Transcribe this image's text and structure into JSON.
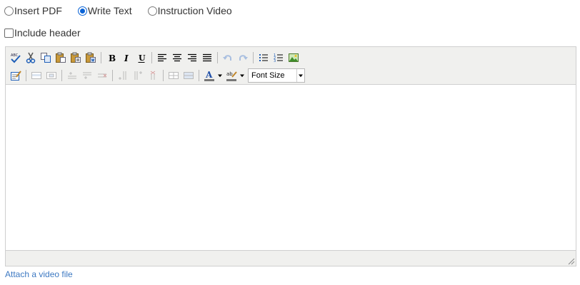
{
  "content_type": {
    "options": [
      {
        "label": "Insert PDF",
        "checked": false
      },
      {
        "label": "Write Text",
        "checked": true
      },
      {
        "label": "Instruction Video",
        "checked": false
      }
    ]
  },
  "include_header": {
    "label": "Include header",
    "checked": false
  },
  "editor": {
    "toolbar_row1": [
      "spellcheck-icon",
      "cut-icon",
      "copy-icon",
      "paste-icon",
      "paste-text-icon",
      "paste-word-icon",
      "bold-icon",
      "italic-icon",
      "underline-icon",
      "align-left-icon",
      "align-center-icon",
      "align-right-icon",
      "align-justify-icon",
      "undo-icon",
      "redo-icon",
      "unordered-list-icon",
      "ordered-list-icon",
      "insert-image-icon"
    ],
    "toolbar_row2": [
      "edit-html-icon",
      "table-row-props-icon",
      "table-cell-props-icon",
      "insert-row-before-icon",
      "insert-row-after-icon",
      "delete-row-icon",
      "insert-col-before-icon",
      "insert-col-after-icon",
      "delete-col-icon",
      "split-cells-icon",
      "merge-cells-icon",
      "text-color-icon",
      "highlight-color-icon"
    ],
    "font_size": {
      "placeholder": "Font Size"
    },
    "body_text": ""
  },
  "attach_link": {
    "label": "Attach a video file"
  },
  "colors": {
    "radio_accent": "#0a63d6",
    "link": "#3d79c2",
    "toolbar_bg": "#f0f0ee"
  }
}
